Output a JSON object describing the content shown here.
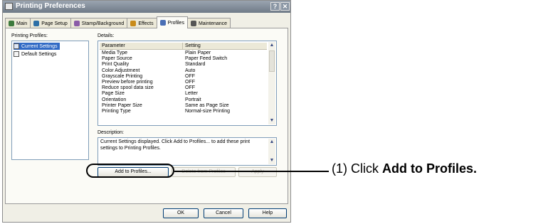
{
  "window": {
    "title": "Printing Preferences",
    "help_button": "?",
    "close_button": "✕"
  },
  "tabs": [
    {
      "label": "Main",
      "icon": "main-icon",
      "color": "#3d7a3d",
      "active": false
    },
    {
      "label": "Page Setup",
      "icon": "page-setup-icon",
      "color": "#2d6fa6",
      "active": false
    },
    {
      "label": "Stamp/Background",
      "icon": "stamp-icon",
      "color": "#8a5ba8",
      "active": false
    },
    {
      "label": "Effects",
      "icon": "effects-icon",
      "color": "#c98b1a",
      "active": false
    },
    {
      "label": "Profiles",
      "icon": "profiles-icon",
      "color": "#4a6fb5",
      "active": true
    },
    {
      "label": "Maintenance",
      "icon": "maintenance-icon",
      "color": "#555555",
      "active": false
    }
  ],
  "profiles": {
    "label": "Printing Profiles:",
    "items": [
      "Current Settings",
      "Default Settings"
    ],
    "selected": "Current Settings"
  },
  "details": {
    "label": "Details:",
    "columns": [
      "Parameter",
      "Setting"
    ],
    "rows": [
      [
        "Media Type",
        "Plain Paper"
      ],
      [
        "Paper Source",
        "Paper Feed Switch"
      ],
      [
        "Print Quality",
        "Standard"
      ],
      [
        "Color Adjustment",
        "Auto"
      ],
      [
        "Grayscale Printing",
        "OFF"
      ],
      [
        "Preview before printing",
        "OFF"
      ],
      [
        "Reduce spool data size",
        "OFF"
      ],
      [
        "Page Size",
        "Letter"
      ],
      [
        "Orientation",
        "Portrait"
      ],
      [
        "Printer Paper Size",
        "Same as Page Size"
      ],
      [
        "Printing Type",
        "Normal-size Printing"
      ]
    ]
  },
  "description": {
    "label": "Description:",
    "text": "Current Settings displayed. Click Add to Profiles... to add these print settings to Printing Profiles."
  },
  "buttons": {
    "add": "Add to Profiles...",
    "delete": "Delete from Profiles",
    "apply": "Apply",
    "ok": "OK",
    "cancel": "Cancel",
    "help": "Help"
  },
  "callout": {
    "prefix": "(1) Click ",
    "bold": "Add to Profiles."
  }
}
